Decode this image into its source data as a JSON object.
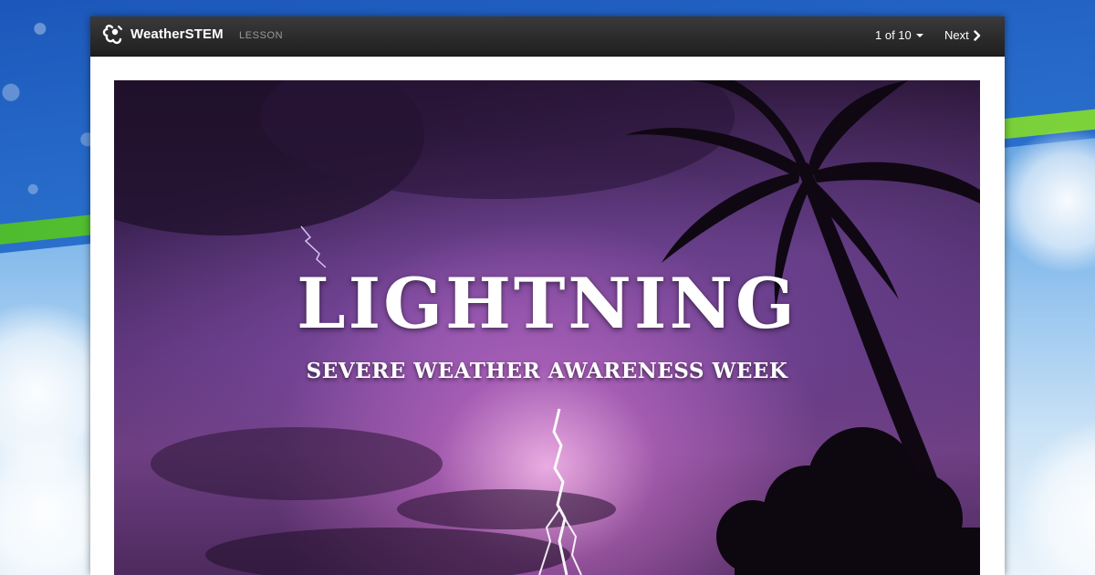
{
  "app": {
    "brand": "WeatherSTEM",
    "section_tag": "LESSON"
  },
  "nav": {
    "page_counter": "1 of 10",
    "next_label": "Next"
  },
  "slide": {
    "title": "LIGHTNING",
    "subtitle": "SEVERE WEATHER AWARENESS WEEK"
  },
  "icons": {
    "logo": "weatherstem-logo-icon",
    "page_menu": "caret-down-icon",
    "next": "chevron-right-icon"
  },
  "colors": {
    "navbar": "#262626",
    "lesson_tag": "#9a9a9a",
    "background_blue": "#2466c6",
    "background_green": "#6cc935",
    "slide_purple": "#5a3478"
  }
}
